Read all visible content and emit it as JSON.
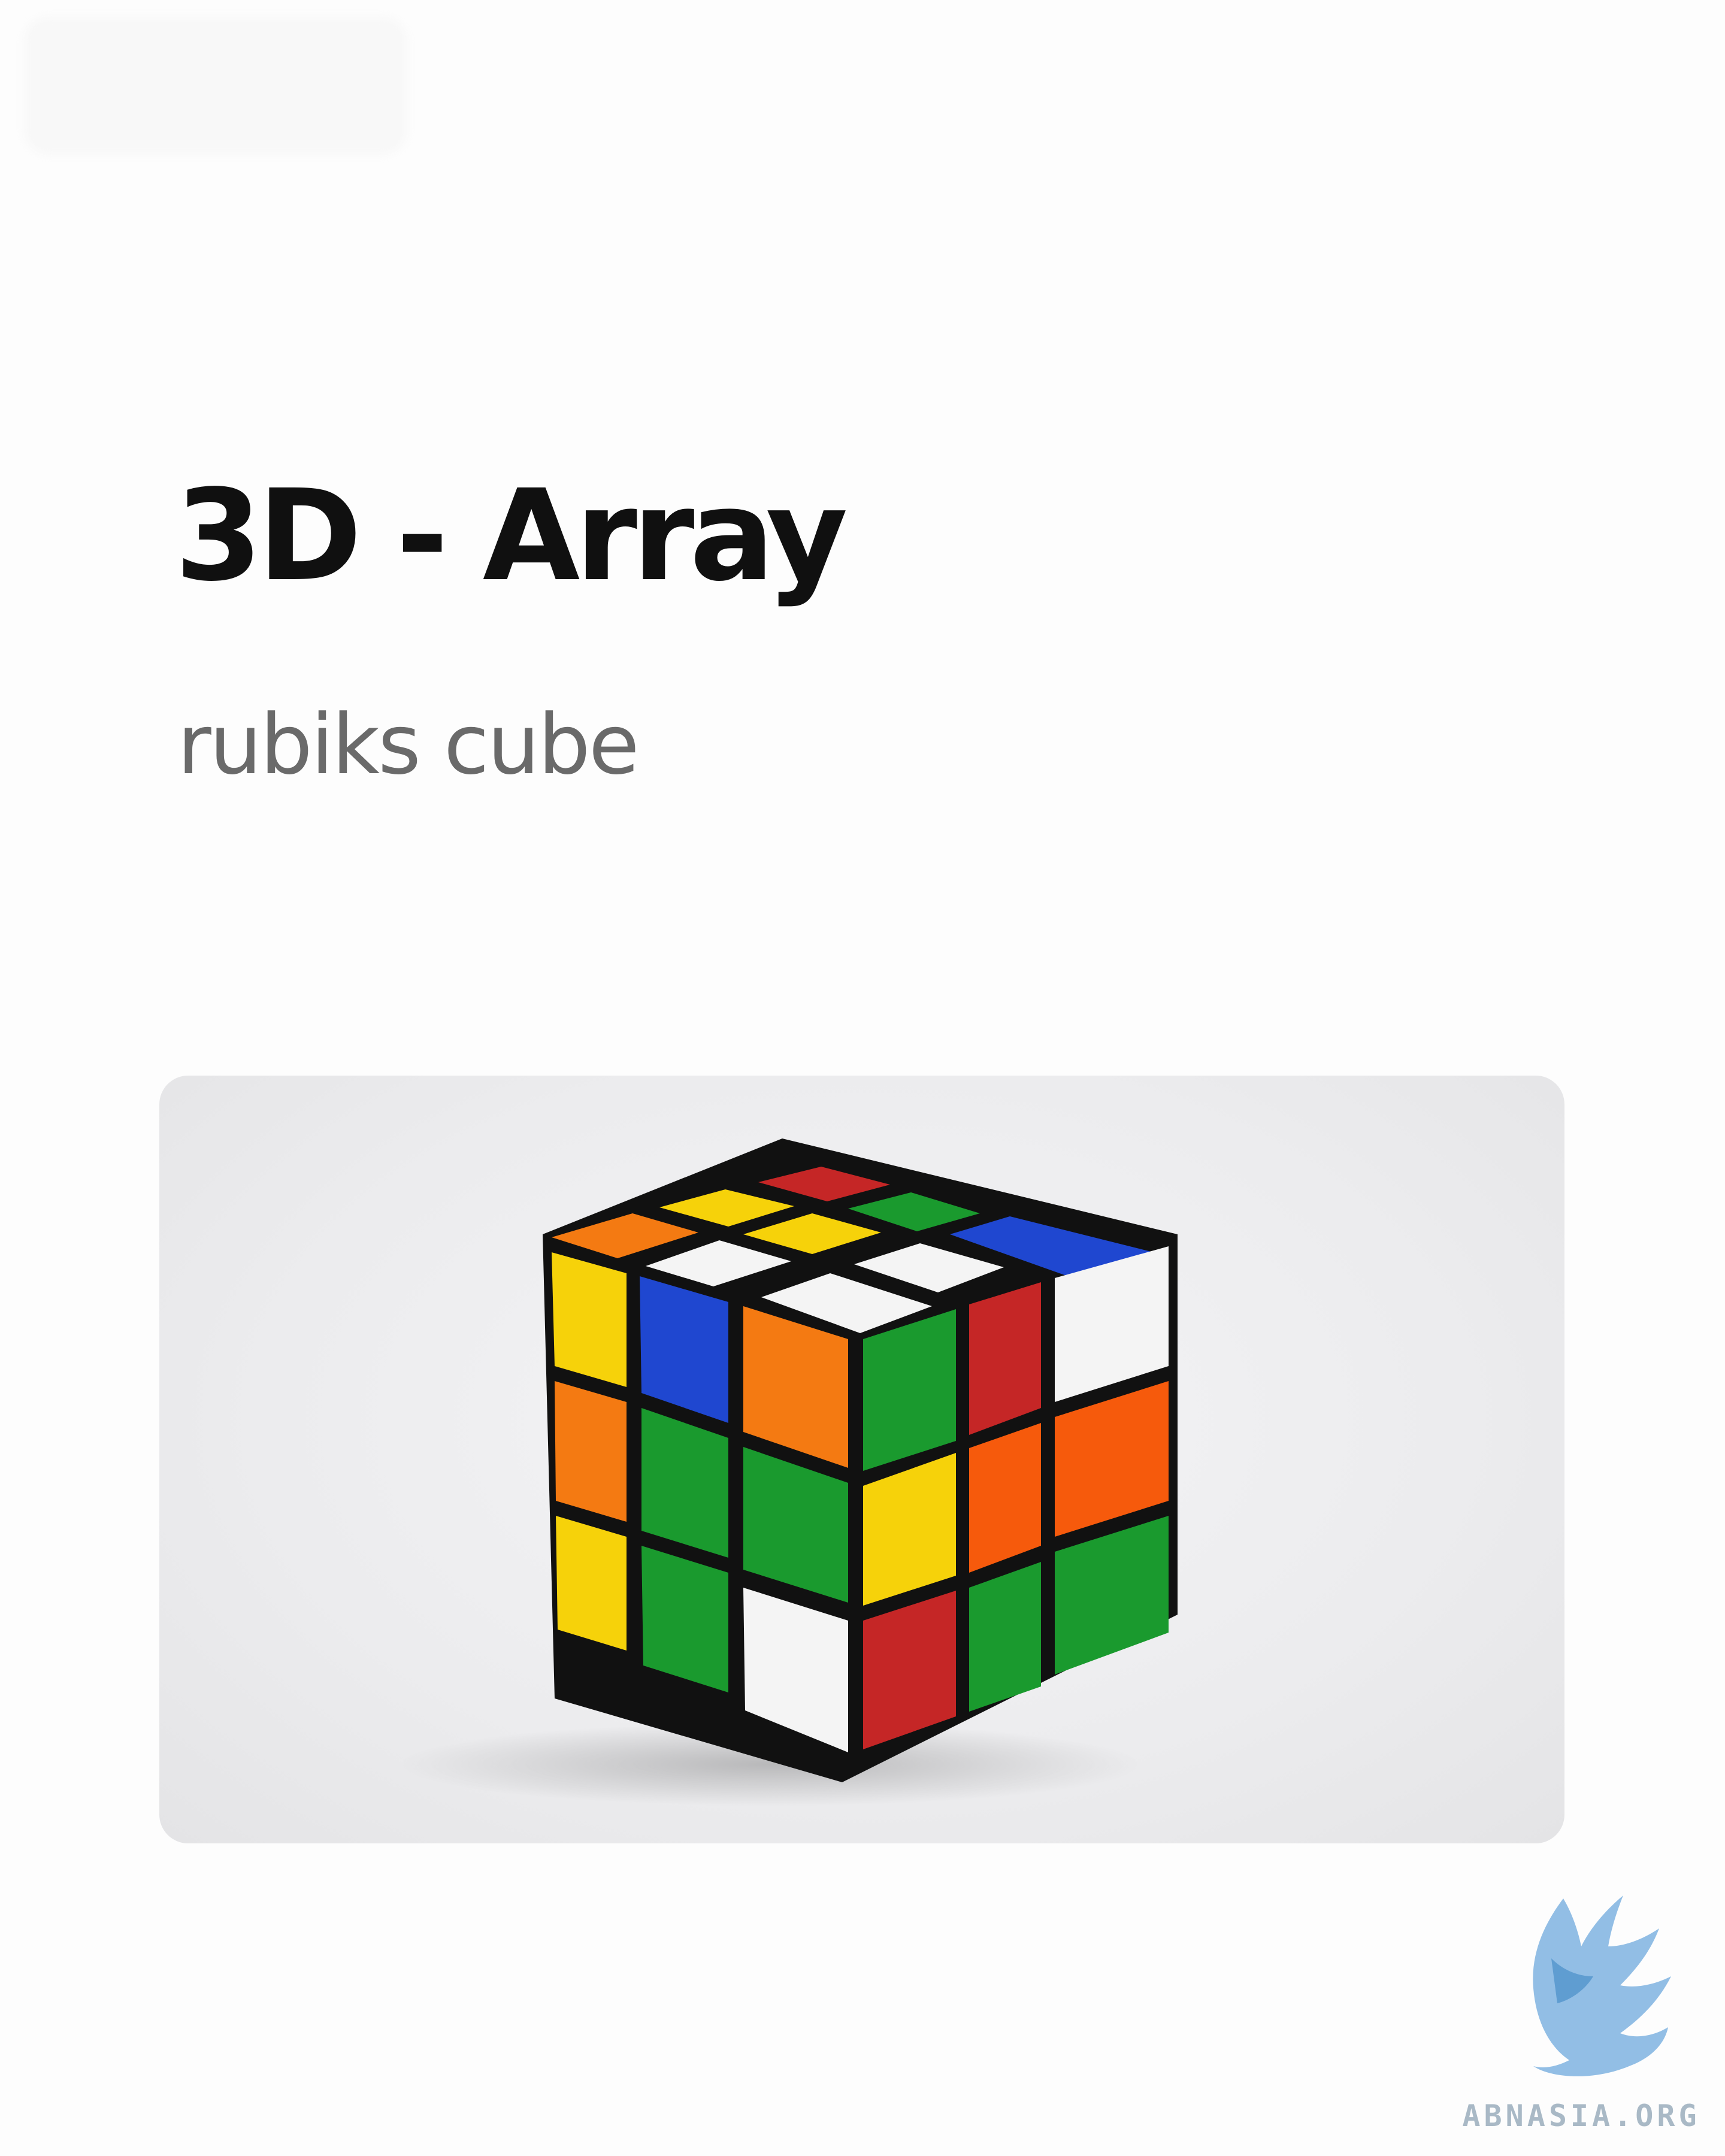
{
  "slide": {
    "title": "3D - Array",
    "subtitle": "rubiks cube"
  },
  "image": {
    "description_icon": "rubiks-cube-photo",
    "colors": {
      "black": "#111111",
      "white": "#f4f4f4",
      "yellow": "#f6d20a",
      "orange": "#f47a12",
      "red": "#c52626",
      "green": "#1a9a2e",
      "blue": "#1f47d0"
    }
  },
  "watermark": {
    "text": "ABNASIA.ORG",
    "icon": "griffin-icon",
    "color": "#7fb3e0"
  }
}
